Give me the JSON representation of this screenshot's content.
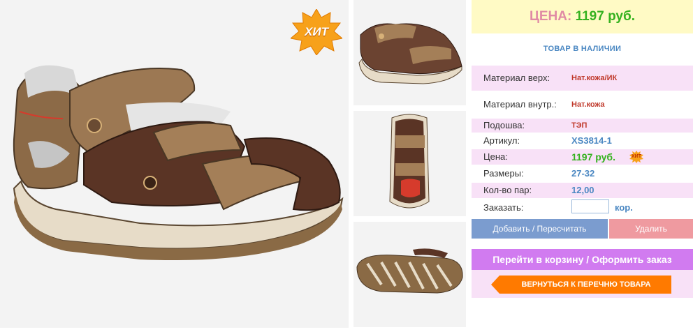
{
  "product": {
    "hit_badge": "ХИТ",
    "main_image_alt": "sandal-main-photo",
    "thumbs": [
      "sandal-side-view",
      "sandal-top-view",
      "sandal-sole-view"
    ]
  },
  "price": {
    "label": "ЦЕНА:",
    "value": "1197 руб."
  },
  "stock_status": "ТОВАР В НАЛИЧИИ",
  "specs": [
    {
      "label": "Материал верх:",
      "value": "Нат.кожа/ИК",
      "color": "#c0392b"
    },
    {
      "label": "Материал внутр.:",
      "value": "Нат.кожа",
      "color": "#c0392b"
    },
    {
      "label": "Подошва:",
      "value": "ТЭП",
      "color": "#c0392b"
    },
    {
      "label": "Артикул:",
      "value": "XS3814-1",
      "color": "#4a87c2"
    },
    {
      "label": "Цена:",
      "value": "1197 руб.",
      "color": "#35b21f"
    },
    {
      "label": "Размеры:",
      "value": "27-32",
      "color": "#4a87c2"
    },
    {
      "label": "Кол-во пар:",
      "value": "12,00",
      "color": "#4a87c2"
    }
  ],
  "order": {
    "label": "Заказать:",
    "value": "",
    "unit": "кор."
  },
  "mini_hit": "ХИТ",
  "buttons": {
    "add": "Добавить / Пересчитать",
    "delete": "Удалить",
    "cart": "Перейти в корзину / Оформить заказ",
    "back": "ВЕРНУТЬСЯ К ПЕРЕЧНЮ ТОВАРА"
  },
  "colors": {
    "price_bg": "#fffac5",
    "price_label": "#e08aa5",
    "price_value": "#35b21f",
    "pink_row": "#f8e1f7",
    "btn_add": "#7b9ccf",
    "btn_delete": "#ef9aa0",
    "btn_cart": "#d17bf0",
    "btn_back": "#ff7a00"
  }
}
